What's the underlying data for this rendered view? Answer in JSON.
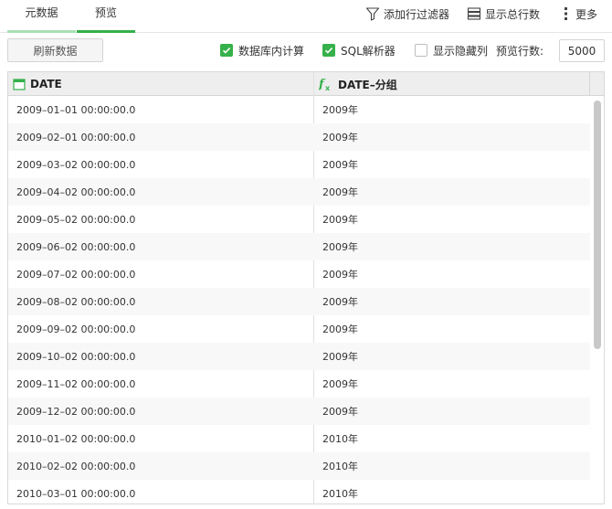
{
  "tabs": [
    {
      "label": "元数据"
    },
    {
      "label": "预览"
    }
  ],
  "toolbar": {
    "add_filter": "添加行过滤器",
    "show_total": "显示总行数",
    "more": "更多"
  },
  "options": {
    "refresh_label": "刷新数据",
    "db_compute": {
      "label": "数据库内计算",
      "checked": true
    },
    "sql_parser": {
      "label": "SQL解析器",
      "checked": true
    },
    "show_hidden": {
      "label": "显示隐藏列",
      "checked": false
    },
    "preview_rows_label": "预览行数:",
    "preview_rows_value": "5000"
  },
  "table": {
    "columns": [
      {
        "label": "DATE",
        "icon": "calendar-icon"
      },
      {
        "label": "DATE–分组",
        "icon": "formula-icon"
      }
    ],
    "rows": [
      [
        "2009–01–01 00:00:00.0",
        "2009年"
      ],
      [
        "2009–02–01 00:00:00.0",
        "2009年"
      ],
      [
        "2009–03–02 00:00:00.0",
        "2009年"
      ],
      [
        "2009–04–02 00:00:00.0",
        "2009年"
      ],
      [
        "2009–05–02 00:00:00.0",
        "2009年"
      ],
      [
        "2009–06–02 00:00:00.0",
        "2009年"
      ],
      [
        "2009–07–02 00:00:00.0",
        "2009年"
      ],
      [
        "2009–08–02 00:00:00.0",
        "2009年"
      ],
      [
        "2009–09–02 00:00:00.0",
        "2009年"
      ],
      [
        "2009–10–02 00:00:00.0",
        "2009年"
      ],
      [
        "2009–11–02 00:00:00.0",
        "2009年"
      ],
      [
        "2009–12–02 00:00:00.0",
        "2009年"
      ],
      [
        "2010–01–02 00:00:00.0",
        "2010年"
      ],
      [
        "2010–02–02 00:00:00.0",
        "2010年"
      ],
      [
        "2010–03–01 00:00:00.0",
        "2010年"
      ]
    ]
  },
  "colors": {
    "accent": "#35b04a",
    "accent_light": "#a9e0b4"
  }
}
